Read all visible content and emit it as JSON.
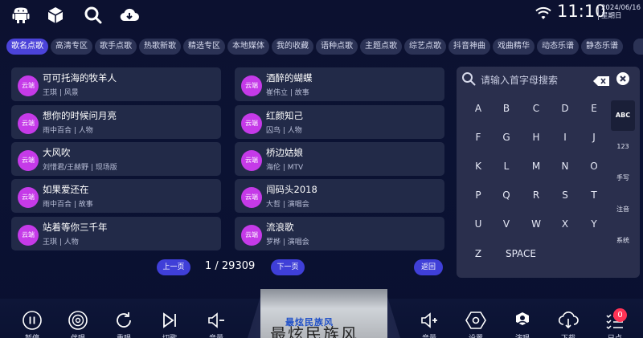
{
  "status": {
    "time": "11:10",
    "date": "2024/06/16",
    "weekday": "星期日"
  },
  "top_icons": [
    "android-icon",
    "cube-icon",
    "search-icon",
    "cloud-download-icon"
  ],
  "tabs": [
    {
      "label": "歌名点歌",
      "active": true
    },
    {
      "label": "高清专区"
    },
    {
      "label": "歌手点歌"
    },
    {
      "label": "热歌新歌"
    },
    {
      "label": "精选专区"
    },
    {
      "label": "本地媒体"
    },
    {
      "label": "我的收藏"
    },
    {
      "label": "语种点歌"
    },
    {
      "label": "主题点歌"
    },
    {
      "label": "综艺点歌"
    },
    {
      "label": "抖音神曲"
    },
    {
      "label": "戏曲精华"
    },
    {
      "label": "动态乐谱"
    },
    {
      "label": "静态乐谱"
    }
  ],
  "songs": [
    {
      "badge": "云端",
      "title": "可可托海的牧羊人",
      "meta": "王琪 | 风景"
    },
    {
      "badge": "云端",
      "title": "想你的时候问月亮",
      "meta": "雨中百合 | 人物"
    },
    {
      "badge": "云端",
      "title": "大风吹",
      "meta": "刘惜君/王赫野 | 现场版"
    },
    {
      "badge": "云端",
      "title": "如果爱还在",
      "meta": "雨中百合 | 故事"
    },
    {
      "badge": "云端",
      "title": "站着等你三千年",
      "meta": "王琪 | 人物"
    },
    {
      "badge": "云端",
      "title": "酒醉的蝴蝶",
      "meta": "崔伟立 | 故事"
    },
    {
      "badge": "云端",
      "title": "红颜知己",
      "meta": "囚鸟 | 人物"
    },
    {
      "badge": "云端",
      "title": "桥边姑娘",
      "meta": "海伦 | MTV"
    },
    {
      "badge": "云端",
      "title": "闯码头2018",
      "meta": "大哲 | 演唱会"
    },
    {
      "badge": "云端",
      "title": "流浪歌",
      "meta": "罗桦 | 演唱会"
    }
  ],
  "pager": {
    "prev": "上一页",
    "next": "下一页",
    "page": "1 / 29309",
    "back": "返回"
  },
  "keyboard": {
    "placeholder": "请输入首字母搜索",
    "keys": [
      "A",
      "B",
      "C",
      "D",
      "E",
      "F",
      "G",
      "H",
      "I",
      "J",
      "K",
      "L",
      "M",
      "N",
      "O",
      "P",
      "Q",
      "R",
      "S",
      "T",
      "U",
      "V",
      "W",
      "X",
      "Y",
      "Z"
    ],
    "space": "SPACE",
    "modes": [
      {
        "label": "ABC",
        "active": true
      },
      {
        "label": "123"
      },
      {
        "label": "手写"
      },
      {
        "label": "注音"
      },
      {
        "label": "系统"
      }
    ]
  },
  "bottom": {
    "items": [
      {
        "label": "暂停",
        "icon": "pause-icon"
      },
      {
        "label": "伴唱",
        "icon": "accompany-icon"
      },
      {
        "label": "重唱",
        "icon": "replay-icon"
      },
      {
        "label": "切歌",
        "icon": "next-icon"
      },
      {
        "label": "音量",
        "icon": "volume-down-icon"
      },
      {
        "label": "音量",
        "icon": "volume-up-icon"
      },
      {
        "label": "设置",
        "icon": "settings-icon"
      },
      {
        "label": "演唱",
        "icon": "singer-icon"
      },
      {
        "label": "下载",
        "icon": "download-icon"
      },
      {
        "label": "已点",
        "icon": "queue-icon"
      }
    ],
    "queue_count": "0",
    "video_title": "最炫民族风",
    "video_calligraphy": "最炫民族风"
  },
  "colors": {
    "accent": "#4b43d9",
    "badge": "#c53ae8",
    "card": "#222a48",
    "notif": "#ff3355"
  }
}
